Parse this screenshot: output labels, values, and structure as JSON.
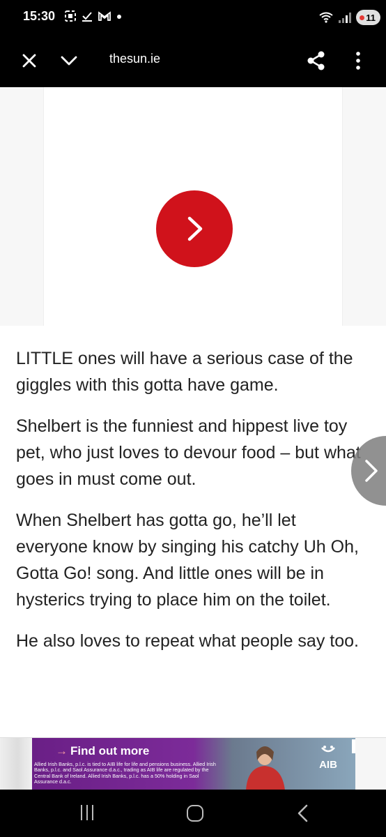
{
  "status_bar": {
    "time": "15:30",
    "battery": "11",
    "icons": [
      "screenshot-icon",
      "download-done-icon",
      "gmail-icon",
      "dot-icon",
      "wifi-icon",
      "signal-icon",
      "battery-icon"
    ]
  },
  "toolbar": {
    "url": "thesun.ie",
    "icons": [
      "close-icon",
      "chevron-down-icon",
      "share-icon",
      "more-vert-icon"
    ]
  },
  "article": {
    "paragraphs": [
      "LITTLE ones will have a serious case of the giggles with this gotta have game.",
      "Shelbert is the funniest and hippest live toy pet, who just loves to devour food – but what goes in must come out.",
      "When Shelbert has gotta go, he’ll let everyone know by singing his catchy Uh Oh, Gotta Go! song. And little ones will be in hysterics trying to place him on the toilet.",
      "He also loves to repeat what people say too."
    ]
  },
  "banner": {
    "cta": "Find out more",
    "fine_print": "Allied Irish Banks, p.l.c. is tied to AIB life for life and pensions business. Allied Irish Banks, p.l.c. and Saol Assurance d.a.c., trading as AIB life are regulated by the Central Bank of Ireland. Allied Irish Banks, p.l.c. has a 50% holding in Saol Assurance d.a.c.",
    "brand": "AIB",
    "colors": {
      "purple": "#6a1f86",
      "accent_red": "#d0121b"
    }
  },
  "navbar": {
    "icons": [
      "recent-apps-icon",
      "home-icon",
      "back-icon"
    ]
  }
}
